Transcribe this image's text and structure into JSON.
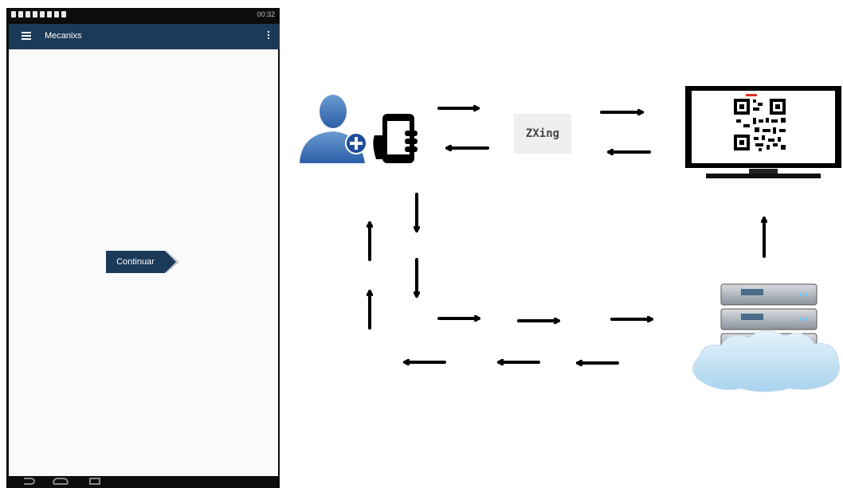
{
  "phone": {
    "status_time": "00:32",
    "app_title": "Mecanixs",
    "continue_label": "Continuar",
    "menu_icon": "hamburger-menu-icon",
    "overflow_icon": "more-vert-icon"
  },
  "diagram": {
    "zxing_label": "ZXing"
  }
}
